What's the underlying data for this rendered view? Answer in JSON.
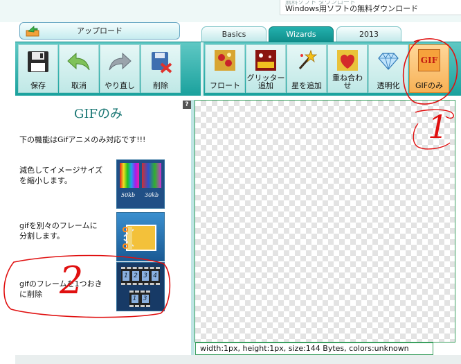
{
  "banner": {
    "ad_line_top": "無料ソフト ダウンロード",
    "ad_line": "Windows用ソフトの無料ダウンロード"
  },
  "upload": {
    "label": "アップロード"
  },
  "tabs": [
    {
      "label": "Basics",
      "active": false
    },
    {
      "label": "Wizards",
      "active": true
    },
    {
      "label": "2013",
      "active": false
    }
  ],
  "toolbar": {
    "left_tools": [
      {
        "label": "保存",
        "icon": "save-icon"
      },
      {
        "label": "取消",
        "icon": "undo-icon"
      },
      {
        "label": "やり直し",
        "icon": "redo-icon"
      },
      {
        "label": "削除",
        "icon": "delete-icon"
      }
    ],
    "right_tools": [
      {
        "label": "フロート",
        "icon": "float-icon"
      },
      {
        "label": "グリッター追加",
        "label_l1": "グリッター",
        "label_l2": "追加",
        "icon": "glitter-icon"
      },
      {
        "label": "星を追加",
        "icon": "star-wand-icon"
      },
      {
        "label": "重ね合わせ",
        "label_l1": "重ね合わ",
        "label_l2": "せ",
        "icon": "overlay-icon"
      },
      {
        "label": "透明化",
        "icon": "diamond-icon"
      },
      {
        "label": "GIFのみ",
        "icon": "gif-icon",
        "icon_text": "GIF",
        "active": true
      }
    ]
  },
  "panel": {
    "help": "?",
    "title": "GIFのみ",
    "note": "下の機能はGifアニメのみ対応です!!!",
    "features": [
      {
        "text": "減色してイメージサイズを縮小します。",
        "line1": "減色してイメージサイズ",
        "line2": "を縮小します。",
        "icon": "reduce-colors-icon",
        "size_a": "50kb",
        "size_b": "30kb"
      },
      {
        "text": "gifを別々のフレームに分割します。",
        "line1": "gifを別々のフレームに",
        "line2": "分割します。",
        "icon": "split-frames-icon"
      },
      {
        "text": "gifのフレームを1つおきに削除",
        "line1": "gifのフレームを1つおき",
        "line2": "に削除",
        "icon": "drop-frames-icon",
        "frames": [
          "1",
          "2",
          "3",
          "4",
          "1",
          "3"
        ]
      }
    ]
  },
  "status": {
    "text": "width:1px, height:1px, size:144 Bytes, colors:unknown"
  },
  "annotations": {
    "mark1": "1",
    "mark2": "2",
    "color": "#e01010"
  },
  "colors": {
    "toolbar": "#1aa19d",
    "active_tab": "#108e8b",
    "active_tool": "#f7b155",
    "title": "#1a7774"
  }
}
